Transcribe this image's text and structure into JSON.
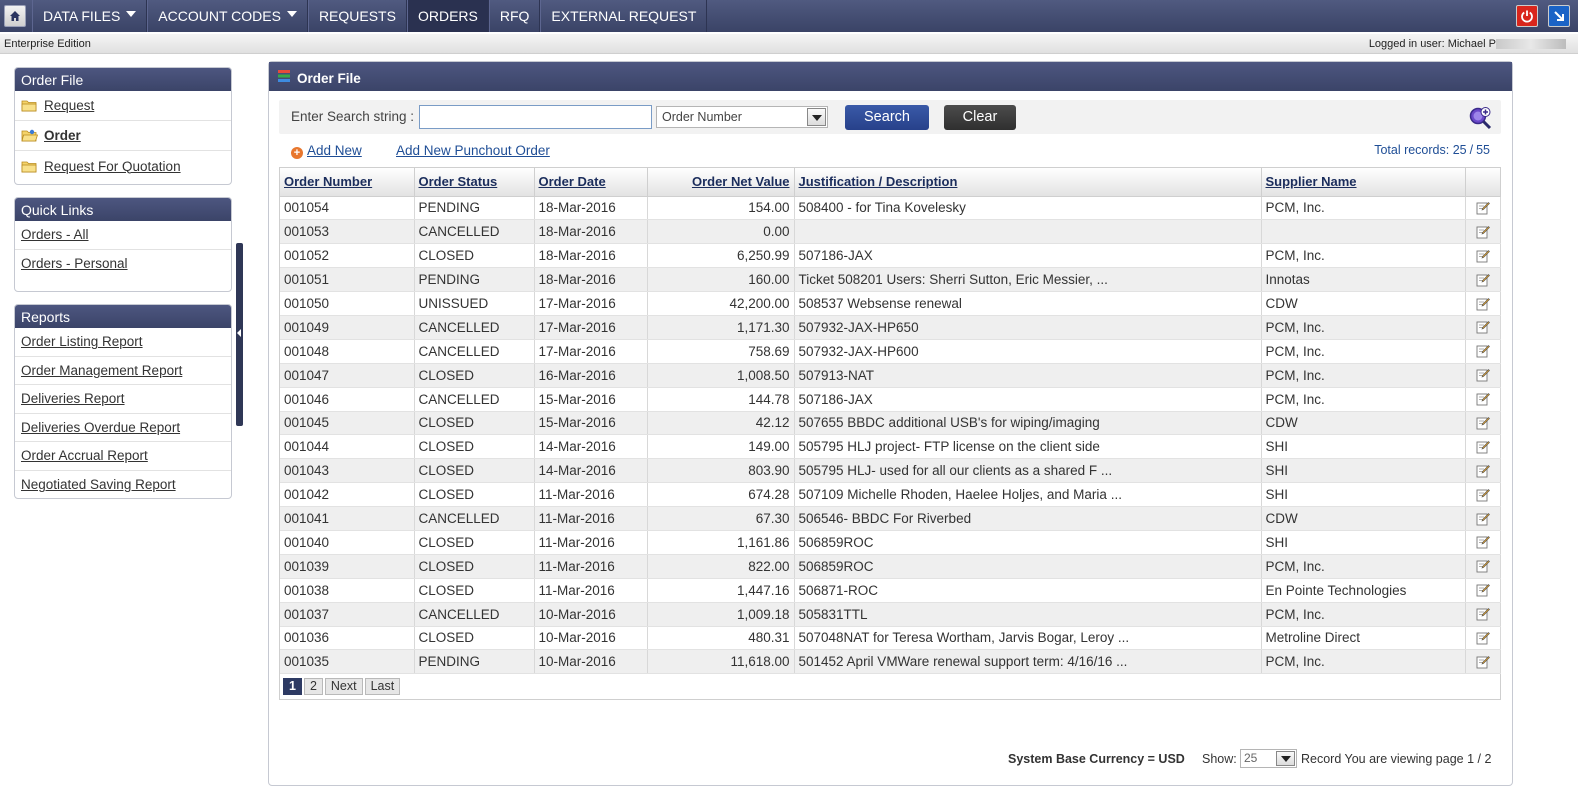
{
  "nav": {
    "items": [
      {
        "label": "DATA FILES",
        "dropdown": true,
        "active": false
      },
      {
        "label": "ACCOUNT CODES",
        "dropdown": true,
        "active": false
      },
      {
        "label": "REQUESTS",
        "dropdown": false,
        "active": false
      },
      {
        "label": "ORDERS",
        "dropdown": false,
        "active": true
      },
      {
        "label": "RFQ",
        "dropdown": false,
        "active": false
      },
      {
        "label": "EXTERNAL REQUEST",
        "dropdown": false,
        "active": false
      }
    ],
    "icons": {
      "home": "home-icon",
      "power": "power-icon",
      "pop_out": "arrow-icon"
    },
    "colors": {
      "bar": "#3f4870",
      "active": "#2a3150",
      "power": "#d9261c",
      "pop_out": "#1b63c6"
    }
  },
  "status": {
    "edition": "Enterprise Edition",
    "logged_in": "Logged in user: Michael P"
  },
  "sidebar": {
    "order_file": {
      "title": "Order File",
      "items": [
        {
          "label": "Request",
          "bold": false
        },
        {
          "label": "Order",
          "bold": true
        },
        {
          "label": "Request For Quotation",
          "bold": false
        }
      ]
    },
    "quick_links": {
      "title": "Quick Links",
      "items": [
        "Orders - All",
        "Orders - Personal"
      ]
    },
    "reports": {
      "title": "Reports",
      "items": [
        "Order Listing Report",
        "Order Management Report",
        "Deliveries Report",
        "Deliveries Overdue Report",
        "Order Accrual Report",
        "Negotiated Saving Report"
      ]
    }
  },
  "main": {
    "title": "Order File",
    "search": {
      "label": "Enter Search string :",
      "value": "",
      "field": "Order Number",
      "search_btn": "Search",
      "clear_btn": "Clear"
    },
    "actions": {
      "add_new": "Add New",
      "add_punchout": "Add New Punchout Order"
    },
    "total": {
      "label": "Total records:",
      "shown": "25",
      "sep": "/",
      "total": "55"
    },
    "columns": [
      "Order Number",
      "Order Status",
      "Order Date",
      "Order Net Value",
      "Justification / Description",
      "Supplier Name"
    ],
    "rows": [
      [
        "001054",
        "PENDING",
        "18-Mar-2016",
        "154.00",
        "508400 - for Tina Kovelesky",
        "PCM, Inc."
      ],
      [
        "001053",
        "CANCELLED",
        "18-Mar-2016",
        "0.00",
        "",
        ""
      ],
      [
        "001052",
        "CLOSED",
        "18-Mar-2016",
        "6,250.99",
        "507186-JAX",
        "PCM, Inc."
      ],
      [
        "001051",
        "PENDING",
        "18-Mar-2016",
        "160.00",
        "Ticket 508201 Users: Sherri Sutton, Eric Messier, ...",
        "Innotas"
      ],
      [
        "001050",
        "UNISSUED",
        "17-Mar-2016",
        "42,200.00",
        "508537 Websense renewal",
        "CDW"
      ],
      [
        "001049",
        "CANCELLED",
        "17-Mar-2016",
        "1,171.30",
        "507932-JAX-HP650",
        "PCM, Inc."
      ],
      [
        "001048",
        "CANCELLED",
        "17-Mar-2016",
        "758.69",
        "507932-JAX-HP600",
        "PCM, Inc."
      ],
      [
        "001047",
        "CLOSED",
        "16-Mar-2016",
        "1,008.50",
        "507913-NAT",
        "PCM, Inc."
      ],
      [
        "001046",
        "CANCELLED",
        "15-Mar-2016",
        "144.78",
        "507186-JAX",
        "PCM, Inc."
      ],
      [
        "001045",
        "CLOSED",
        "15-Mar-2016",
        "42.12",
        "507655 BBDC additional USB's for wiping/imaging",
        "CDW"
      ],
      [
        "001044",
        "CLOSED",
        "14-Mar-2016",
        "149.00",
        "505795 HLJ project- FTP license on the client side",
        "SHI"
      ],
      [
        "001043",
        "CLOSED",
        "14-Mar-2016",
        "803.90",
        "505795 HLJ- used for all our clients as a shared F ...",
        "SHI"
      ],
      [
        "001042",
        "CLOSED",
        "11-Mar-2016",
        "674.28",
        "507109 Michelle Rhoden, Haelee Holjes, and Maria ...",
        "SHI"
      ],
      [
        "001041",
        "CANCELLED",
        "11-Mar-2016",
        "67.30",
        "506546- BBDC For Riverbed",
        "CDW"
      ],
      [
        "001040",
        "CLOSED",
        "11-Mar-2016",
        "1,161.86",
        "506859ROC",
        "SHI"
      ],
      [
        "001039",
        "CLOSED",
        "11-Mar-2016",
        "822.00",
        "506859ROC",
        "PCM, Inc."
      ],
      [
        "001038",
        "CLOSED",
        "11-Mar-2016",
        "1,447.16",
        "506871-ROC",
        "En Pointe Technologies"
      ],
      [
        "001037",
        "CANCELLED",
        "10-Mar-2016",
        "1,009.18",
        "505831TTL",
        "PCM, Inc."
      ],
      [
        "001036",
        "CLOSED",
        "10-Mar-2016",
        "480.31",
        "507048NAT for Teresa Wortham, Jarvis Bogar, Leroy ...",
        "Metroline Direct"
      ],
      [
        "001035",
        "PENDING",
        "10-Mar-2016",
        "11,618.00",
        "501452 April VMWare renewal support term: 4/16/16 ...",
        "PCM, Inc."
      ]
    ],
    "pager": [
      {
        "label": "1",
        "active": true
      },
      {
        "label": "2",
        "active": false
      },
      {
        "label": "Next",
        "active": false
      },
      {
        "label": "Last",
        "active": false
      }
    ],
    "footer": {
      "base_currency": "System Base Currency = USD",
      "show_label": "Show:",
      "page_size": "25",
      "viewing": "Record You are viewing page 1 / 2"
    }
  }
}
